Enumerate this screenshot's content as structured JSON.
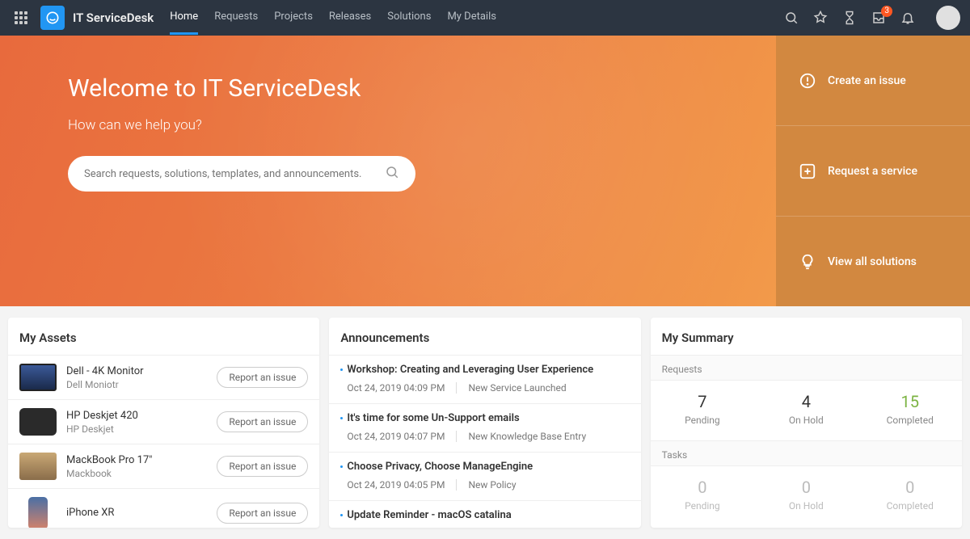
{
  "brand": "IT ServiceDesk",
  "nav": {
    "home": "Home",
    "requests": "Requests",
    "projects": "Projects",
    "releases": "Releases",
    "solutions": "Solutions",
    "mydetails": "My Details"
  },
  "notifications_badge": "3",
  "hero": {
    "title": "Welcome to IT ServiceDesk",
    "subtitle": "How can we help you?",
    "search_placeholder": "Search requests, solutions, templates, and announcements."
  },
  "actions": {
    "create_issue": "Create an issue",
    "request_service": "Request a service",
    "view_solutions": "View all solutions"
  },
  "assets": {
    "title": "My Assets",
    "report_btn": "Report an issue",
    "items": [
      {
        "name": "Dell - 4K Monitor",
        "sub": "Dell Moniotr"
      },
      {
        "name": "HP Deskjet 420",
        "sub": "HP Deskjet"
      },
      {
        "name": "MackBook Pro 17\"",
        "sub": "Mackbook"
      },
      {
        "name": "iPhone XR",
        "sub": ""
      }
    ]
  },
  "announcements": {
    "title": "Announcements",
    "items": [
      {
        "title": "Workshop: Creating and Leveraging User Experience",
        "date": "Oct 24, 2019 04:09 PM",
        "tag": "New Service Launched"
      },
      {
        "title": "It's time for some Un-Support emails",
        "date": "Oct 24, 2019 04:07 PM",
        "tag": "New Knowledge Base Entry"
      },
      {
        "title": "Choose Privacy, Choose ManageEngine",
        "date": "Oct 24, 2019 04:05 PM",
        "tag": "New Policy"
      },
      {
        "title": "Update Reminder - macOS catalina",
        "date": "",
        "tag": ""
      }
    ]
  },
  "summary": {
    "title": "My Summary",
    "requests_label": "Requests",
    "tasks_label": "Tasks",
    "requests": {
      "pending": "7",
      "onhold": "4",
      "completed": "15"
    },
    "tasks": {
      "pending": "0",
      "onhold": "0",
      "completed": "0"
    },
    "labels": {
      "pending": "Pending",
      "onhold": "On Hold",
      "completed": "Completed"
    }
  }
}
